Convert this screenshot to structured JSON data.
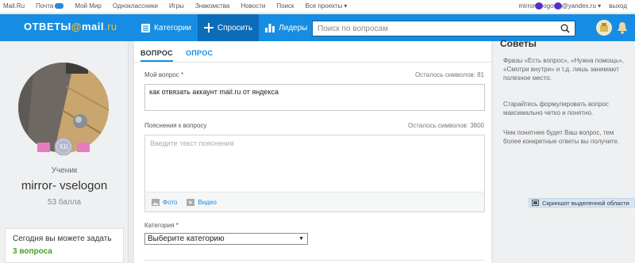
{
  "portal_bar": {
    "links": [
      "Mail.Ru",
      "Почта",
      "Мой Мир",
      "Одноклассники",
      "Игры",
      "Знакомства",
      "Новости",
      "Поиск",
      "Все проекты ▾"
    ],
    "user_email_prefix": "mirror",
    "user_email_suffix": "@yandex.ru ▾",
    "logout": "выход"
  },
  "header": {
    "logo_main": "ОТВЕТЫ",
    "logo_at": "@",
    "logo_mail": "mail",
    "logo_ru": ".ru",
    "nav": [
      {
        "label": "Категории",
        "icon": "categories-icon"
      },
      {
        "label": "Спросить",
        "icon": "plus-icon"
      },
      {
        "label": "Лидеры",
        "icon": "leaders-chart-icon"
      }
    ],
    "search_placeholder": "Поиск по вопросам"
  },
  "profile": {
    "badge_text": "XII",
    "rank": "Ученик",
    "username": "mirror- vselogon",
    "points": "53 балла",
    "quota_text": "Сегодня вы можете задать",
    "quota_count": "3 вопроса"
  },
  "form": {
    "tabs": [
      "ВОПРОС",
      "ОПРОС"
    ],
    "question_label": "Мой вопрос *",
    "question_remaining": "Осталось символов: 81",
    "question_value": "как отвязать аккаунт mail.ru от яндекса",
    "explain_label": "Пояснения к вопросу",
    "explain_remaining": "Осталось символов: 3800",
    "explain_placeholder": "Введите текст пояснения",
    "photo_label": "Фото",
    "video_label": "Видео",
    "category_label": "Категория *",
    "category_value": "Выберите категорию"
  },
  "tips": {
    "heading": "Советы",
    "items": [
      "Фразы «Есть вопрос», «Нужна помощь», «Смотри внутри» и т.д. лишь занимают полезное место.",
      "Старайтесь формулировать вопрос максимально четко и понятно.",
      "Чем понятнее будет Ваш вопрос, тем более конкретные ответы вы получите."
    ]
  },
  "screenshot_tool": "Скриншот выделенной области",
  "colors": {
    "brand_blue": "#168de2",
    "active_nav": "#0d6cb8",
    "accent_orange": "#ffb52e",
    "quota_green": "#4a9b2d"
  }
}
